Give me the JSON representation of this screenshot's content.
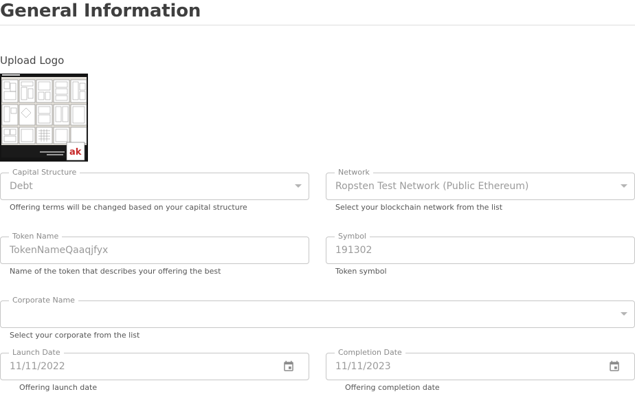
{
  "page": {
    "title": "General Information"
  },
  "upload": {
    "label": "Upload Logo"
  },
  "logo": {
    "brand_text": "ak"
  },
  "fields": {
    "capital_structure": {
      "label": "Capital Structure",
      "value": "Debt",
      "helper": "Offering terms will be changed based on your capital structure",
      "icon": "chevron-down-icon"
    },
    "network": {
      "label": "Network",
      "value": "Ropsten Test Network (Public Ethereum)",
      "helper": "Select your blockchain network from the list",
      "icon": "chevron-down-icon"
    },
    "token_name": {
      "label": "Token Name",
      "value": "TokenNameQaaqjfyx",
      "helper": "Name of the token that describes your offering the best"
    },
    "symbol": {
      "label": "Symbol",
      "value": "191302",
      "helper": "Token symbol"
    },
    "corporate_name": {
      "label": "Corporate Name",
      "value": "",
      "helper": "Select your corporate from the list",
      "icon": "chevron-down-icon"
    },
    "launch_date": {
      "label": "Launch Date",
      "value": "11/11/2022",
      "helper": "Offering launch date",
      "icon": "calendar-icon"
    },
    "completion_date": {
      "label": "Completion Date",
      "value": "11/11/2023",
      "helper": "Offering completion date",
      "icon": "calendar-icon"
    }
  },
  "colors": {
    "border": "#c6c6c6",
    "title": "#3f3f3f",
    "muted_text": "#9a9a9a",
    "label_text": "#8a8a8a"
  }
}
